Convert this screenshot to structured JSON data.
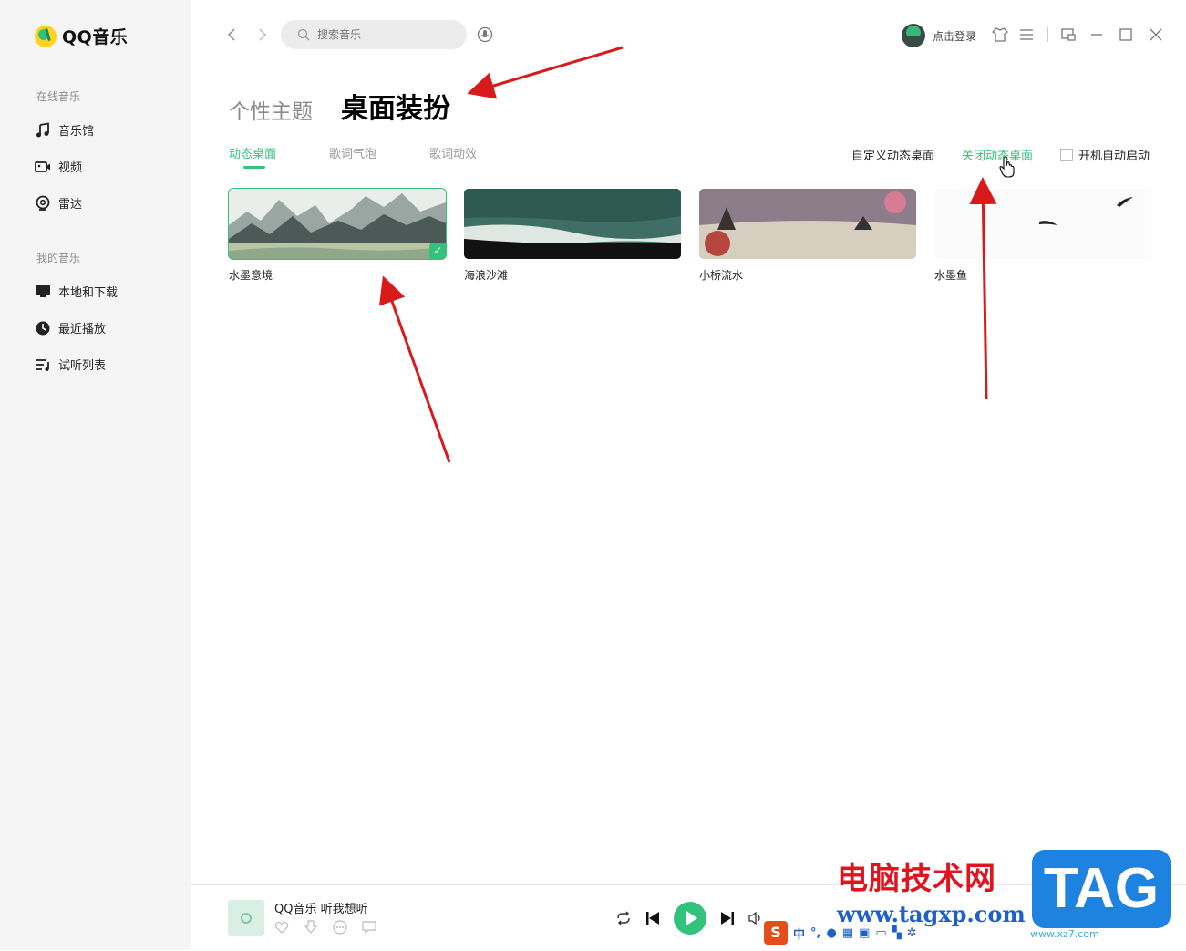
{
  "app": {
    "name": "QQ音乐"
  },
  "sidebar": {
    "section_online": "在线音乐",
    "online_items": [
      {
        "label": "音乐馆",
        "icon": "music-note-icon"
      },
      {
        "label": "视频",
        "icon": "video-icon"
      },
      {
        "label": "雷达",
        "icon": "radar-icon"
      }
    ],
    "section_mine": "我的音乐",
    "mine_items": [
      {
        "label": "本地和下载",
        "icon": "monitor-icon"
      },
      {
        "label": "最近播放",
        "icon": "clock-icon"
      },
      {
        "label": "试听列表",
        "icon": "playlist-icon"
      }
    ]
  },
  "topbar": {
    "search_placeholder": "搜索音乐",
    "login_label": "点击登录"
  },
  "page": {
    "title_inactive": "个性主题",
    "title_active": "桌面装扮",
    "tabs": [
      "动态桌面",
      "歌词气泡",
      "歌词动效"
    ],
    "active_tab": "动态桌面",
    "custom_label": "自定义动态桌面",
    "close_label": "关闭动态桌面",
    "autostart_label": "开机自动启动",
    "autostart_checked": false
  },
  "wallpapers": [
    {
      "label": "水墨意境",
      "selected": true
    },
    {
      "label": "海浪沙滩",
      "selected": false
    },
    {
      "label": "小桥流水",
      "selected": false
    },
    {
      "label": "水墨鱼",
      "selected": false
    }
  ],
  "player": {
    "song": "QQ音乐 听我想听"
  },
  "watermark": {
    "title": "电脑技术网",
    "url": "www.tagxp.com",
    "tag": "TAG",
    "sub": "www.xz7.com"
  },
  "ime": {
    "label": "中"
  },
  "colors": {
    "accent": "#31c27c",
    "arrow": "#d91a1a"
  }
}
